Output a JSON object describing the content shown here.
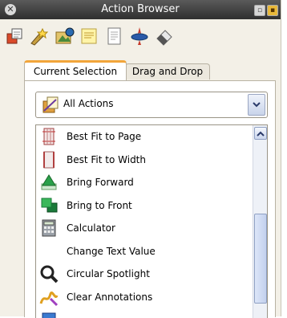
{
  "window": {
    "title": "Action Browser"
  },
  "toolbar": {
    "tools": [
      {
        "icon": "actions-icon"
      },
      {
        "icon": "effects-icon"
      },
      {
        "icon": "media-icon"
      },
      {
        "icon": "notes-icon"
      },
      {
        "icon": "page-icon"
      },
      {
        "icon": "spinner-icon"
      },
      {
        "icon": "eraser-icon"
      }
    ]
  },
  "tabs": [
    {
      "label": "Current Selection",
      "active": true
    },
    {
      "label": "Drag and Drop",
      "active": false
    }
  ],
  "filter": {
    "selected": "All Actions"
  },
  "actions": [
    {
      "label": "Best Fit to Page",
      "icon": "fit-page-icon"
    },
    {
      "label": "Best Fit to Width",
      "icon": "fit-width-icon"
    },
    {
      "label": "Bring Forward",
      "icon": "bring-forward-icon"
    },
    {
      "label": "Bring to Front",
      "icon": "bring-to-front-icon"
    },
    {
      "label": "Calculator",
      "icon": "calculator-icon"
    },
    {
      "label": "Change Text Value",
      "icon": ""
    },
    {
      "label": "Circular Spotlight",
      "icon": "spotlight-icon"
    },
    {
      "label": "Clear Annotations",
      "icon": "clear-annotations-icon"
    }
  ],
  "colors": {
    "accent_tab": "#f2a53a",
    "titlebar": "#3a3a3a",
    "panel_bg": "#f3f0e7"
  }
}
